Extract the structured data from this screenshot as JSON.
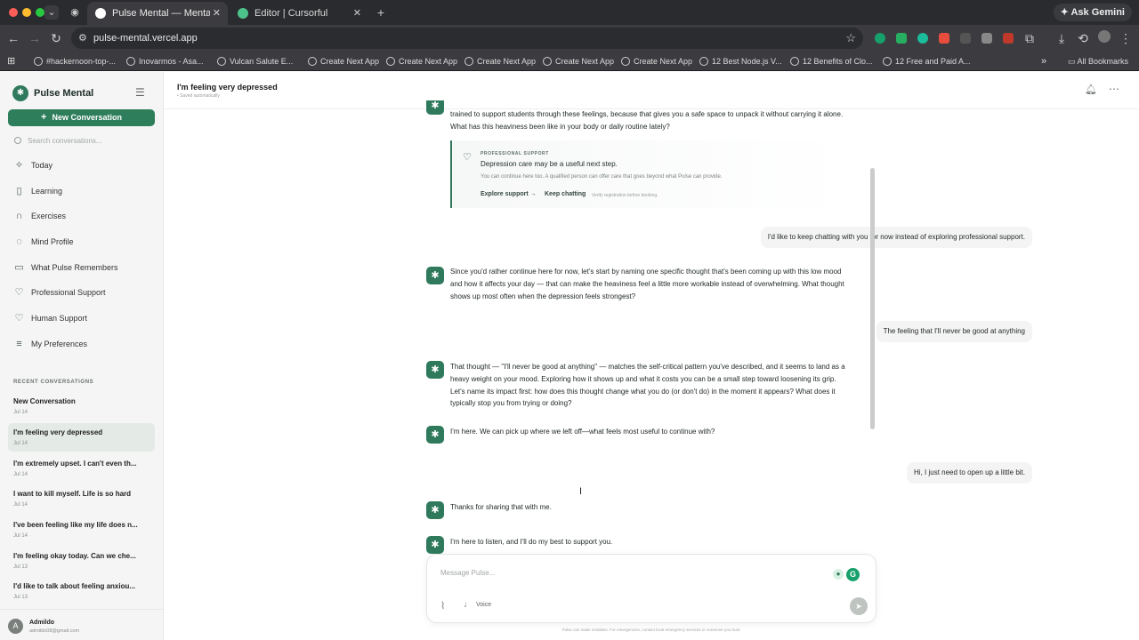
{
  "browser": {
    "tabs": [
      {
        "title": "Pulse Mental — Mental Wellne",
        "close": "✕"
      },
      {
        "title": "Editor | Cursorful",
        "close": "✕"
      }
    ],
    "new_tab": "+",
    "ask_gemini": "Ask Gemini",
    "url": "pulse-mental.vercel.app",
    "bookmarks": [
      "#hackernoon-top-...",
      "Inovarmos - Asa...",
      "Vulcan Salute E...",
      "Create Next App",
      "Create Next App",
      "Create Next App",
      "Create Next App",
      "Create Next App",
      "12 Best Node.js V...",
      "12 Benefits of Clo...",
      "12 Free and Paid A..."
    ],
    "all_bookmarks": "All Bookmarks",
    "colors": {
      "tabbar": "#2a2b2e",
      "toolbar": "#3c3c40"
    }
  },
  "sidebar": {
    "brand": "Pulse Mental",
    "new_conversation": "New Conversation",
    "search_placeholder": "Search conversations...",
    "nav": [
      {
        "label": "Today",
        "icon": "sparkle-icon"
      },
      {
        "label": "Learning",
        "icon": "book-icon"
      },
      {
        "label": "Exercises",
        "icon": "headphones-icon"
      },
      {
        "label": "Mind Profile",
        "icon": "brain-icon"
      },
      {
        "label": "What Pulse Remembers",
        "icon": "book-open-icon"
      },
      {
        "label": "Professional Support",
        "icon": "heart-handshake-icon"
      },
      {
        "label": "Human Support",
        "icon": "heart-icon"
      },
      {
        "label": "My Preferences",
        "icon": "sliders-icon"
      }
    ],
    "recent_heading": "RECENT CONVERSATIONS",
    "conversations": [
      {
        "title": "New Conversation",
        "date": "Jul 14"
      },
      {
        "title": "I'm feeling very depressed",
        "date": "Jul 14"
      },
      {
        "title": "I'm extremely upset. I can't even th...",
        "date": "Jul 14"
      },
      {
        "title": "I want to kill myself. Life is so hard",
        "date": "Jul 14"
      },
      {
        "title": "I've been feeling like my life does n...",
        "date": "Jul 14"
      },
      {
        "title": "I'm feeling okay today. Can we che...",
        "date": "Jul 13"
      },
      {
        "title": "I'd like to talk about feeling anxiou...",
        "date": "Jul 13"
      }
    ],
    "user": {
      "initial": "A",
      "name": "Admildo",
      "email": "admildo08@gmail.com"
    }
  },
  "header": {
    "title": "I'm feeling very depressed",
    "subtitle": "• Saved automatically"
  },
  "messages": {
    "m1": "trained to support students through these feelings, because that gives you a safe space to unpack it without carrying it alone. What has this heaviness been like in your body or daily routine lately?",
    "support": {
      "label": "PROFESSIONAL SUPPORT",
      "title": "Depression care may be a useful next step.",
      "description": "You can continue here too. A qualified person can offer care that goes beyond what Pulse can provide.",
      "explore": "Explore support →",
      "keep": "Keep chatting",
      "verify": "Verify registration before booking."
    },
    "u1": "I'd like to keep chatting with you for now instead of exploring professional support.",
    "b2": "Since you'd rather continue here for now, let's start by naming one specific thought that's been coming up with this low mood and how it affects your day — that can make the heaviness feel a little more workable instead of overwhelming. What thought shows up most often when the depression feels strongest?",
    "u2": "The feeling that I'll never be good at anything",
    "b3": "That thought — \"I'll never be good at anything\" — matches the self-critical pattern you've described, and it seems to land as a heavy weight on your mood. Exploring how it shows up and what it costs you can be a small step toward loosening its grip. Let's name its impact first: how does this thought change what you do (or don't do) in the moment it appears? What does it typically stop you from trying or doing?",
    "b4": "I'm here. We can pick up where we left off—what feels most useful to continue with?",
    "u3": "Hi, I just need to open up a little bit.",
    "b5": "Thanks for sharing that with me.",
    "b6": "I'm here to listen, and I'll do my best to support you."
  },
  "composer": {
    "placeholder": "Message Pulse...",
    "voice": "Voice",
    "disclaimer": "Pulse can make mistakes. For emergencies, contact local emergency services or someone you trust."
  },
  "theme": {
    "accent": "#2e7d5b",
    "sidebar_bg": "#f4f5f4"
  }
}
